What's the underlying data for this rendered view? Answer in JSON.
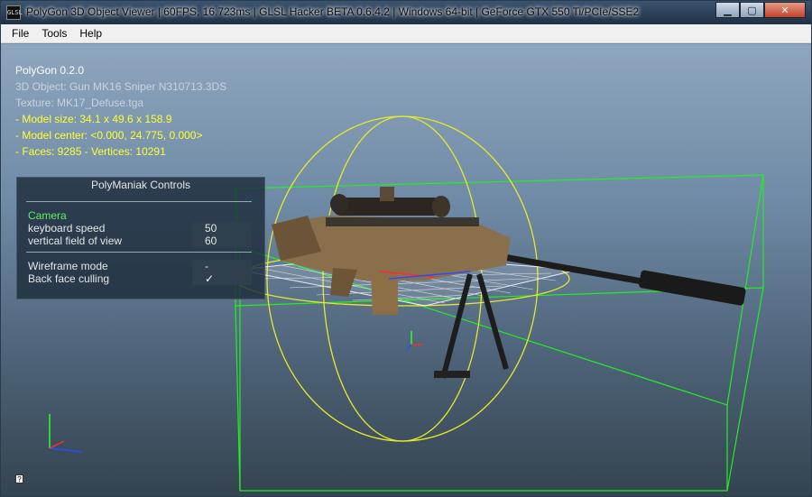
{
  "window": {
    "title": "PolyGon 3D Object Viewer | 60FPS, 16.723ms | GLSL Hacker BETA 0.6.4.2 | Windows 64-bit | GeForce GTX 550 Ti/PCIe/SSE2",
    "app_icon_label": "GLSL",
    "minimize": "▁",
    "maximize": "▢",
    "close": "✕"
  },
  "menu": {
    "items": [
      "File",
      "Tools",
      "Help"
    ]
  },
  "info": {
    "app_name": "PolyGon 0.2.0",
    "object": "3D Object: Gun MK16 Sniper N310713.3DS",
    "texture": "Texture: MK17_Defuse.tga",
    "model_size": "- Model size:  34.1 x 49.6 x 158.9",
    "model_center": "- Model center:  <0.000, 24.775, 0.000>",
    "faces_vertices": "- Faces: 9285 - Vertices: 10291"
  },
  "controls": {
    "title": "PolyManiak Controls",
    "section_camera": "Camera",
    "keyboard_speed_label": "keyboard speed",
    "keyboard_speed_value": "50",
    "fov_label": "vertical field of view",
    "fov_value": "60",
    "wireframe_label": "Wireframe mode",
    "wireframe_value": "-",
    "backface_label": "Back face culling",
    "backface_value": "✓"
  },
  "help_icon": "?",
  "colors": {
    "bbox": "#22ee22",
    "sphere": "#e8e82a",
    "grid": "#ffffff",
    "axis_x": "#ff2b2b",
    "axis_y": "#2bff2b",
    "axis_z": "#2b4bff"
  }
}
